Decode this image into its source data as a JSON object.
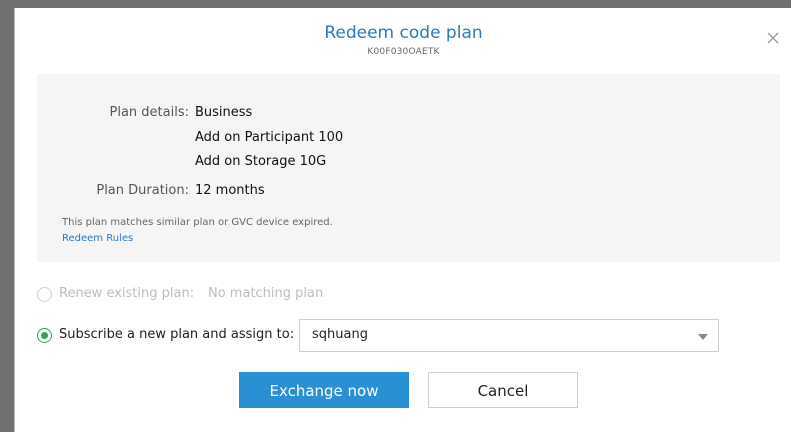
{
  "dialog": {
    "title": "Redeem code plan",
    "code": "K00F030OAETK"
  },
  "plan": {
    "details_label": "Plan details:",
    "details_values": [
      "Business",
      "Add on Participant 100",
      "Add on Storage 10G"
    ],
    "duration_label": "Plan Duration:",
    "duration_value": "12 months",
    "note": "This plan matches similar plan or GVC device expired.",
    "rules_link": "Redeem Rules"
  },
  "options": {
    "renew": {
      "label": "Renew existing plan:",
      "status": "No matching plan",
      "enabled": false,
      "selected": false
    },
    "subscribe": {
      "label": "Subscribe a new plan and assign to:",
      "selected": true,
      "assignee": "sqhuang"
    }
  },
  "buttons": {
    "exchange": "Exchange now",
    "cancel": "Cancel"
  },
  "colors": {
    "accent": "#2a90d6",
    "title": "#2b7ac1",
    "radio_checked": "#2fa44c"
  },
  "icons": {
    "close": "close-icon",
    "dropdown": "chevron-down-icon"
  }
}
